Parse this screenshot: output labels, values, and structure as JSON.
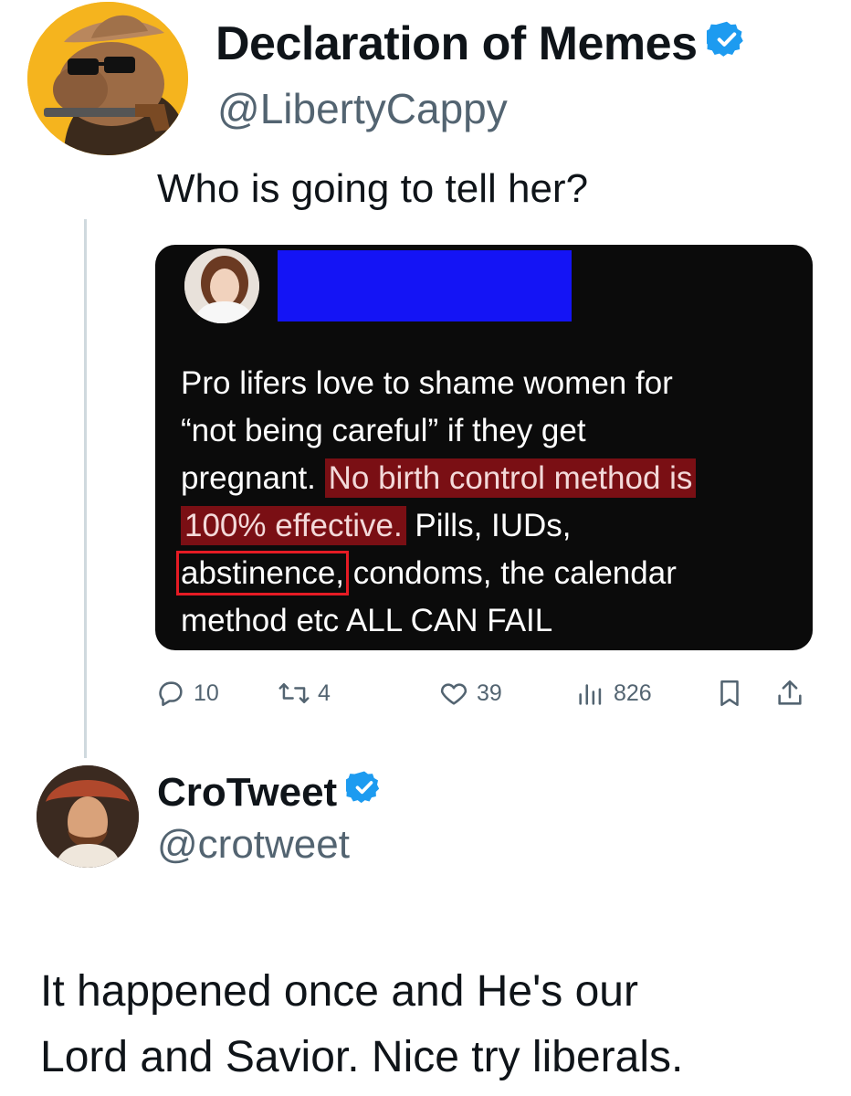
{
  "tweet1": {
    "display_name": "Declaration of Memes",
    "handle": "@LibertyCappy",
    "verified": true,
    "text": "Who is going to tell her?",
    "avatar": "capybara-cowboy-avatar",
    "embed": {
      "avatar": "woman-profile-avatar",
      "redacted_name": "blue-redaction-block",
      "lines": [
        [
          "Pro lifers love to shame women for"
        ],
        [
          "“not being careful” if they get"
        ],
        [
          "pregnant. ",
          "No birth control method is"
        ],
        [
          "100% effective.",
          " Pills, IUDs,"
        ],
        [
          "abstinence,",
          " condoms, the calendar"
        ],
        [
          "method etc ALL CAN FAIL"
        ]
      ]
    },
    "actions": {
      "replies": "10",
      "retweets": "4",
      "likes": "39",
      "views": "826"
    }
  },
  "tweet2": {
    "display_name": "CroTweet",
    "handle": "@crotweet",
    "verified": true,
    "avatar": "portrait-avatar",
    "text_lines": [
      "It happened once and He's our",
      "Lord and Savior. Nice try liberals."
    ]
  },
  "colors": {
    "verified": "#1d9bf0",
    "muted": "#536471",
    "highlight": "#7a0f14",
    "box": "#e51b24",
    "redaction": "#1414f5"
  }
}
